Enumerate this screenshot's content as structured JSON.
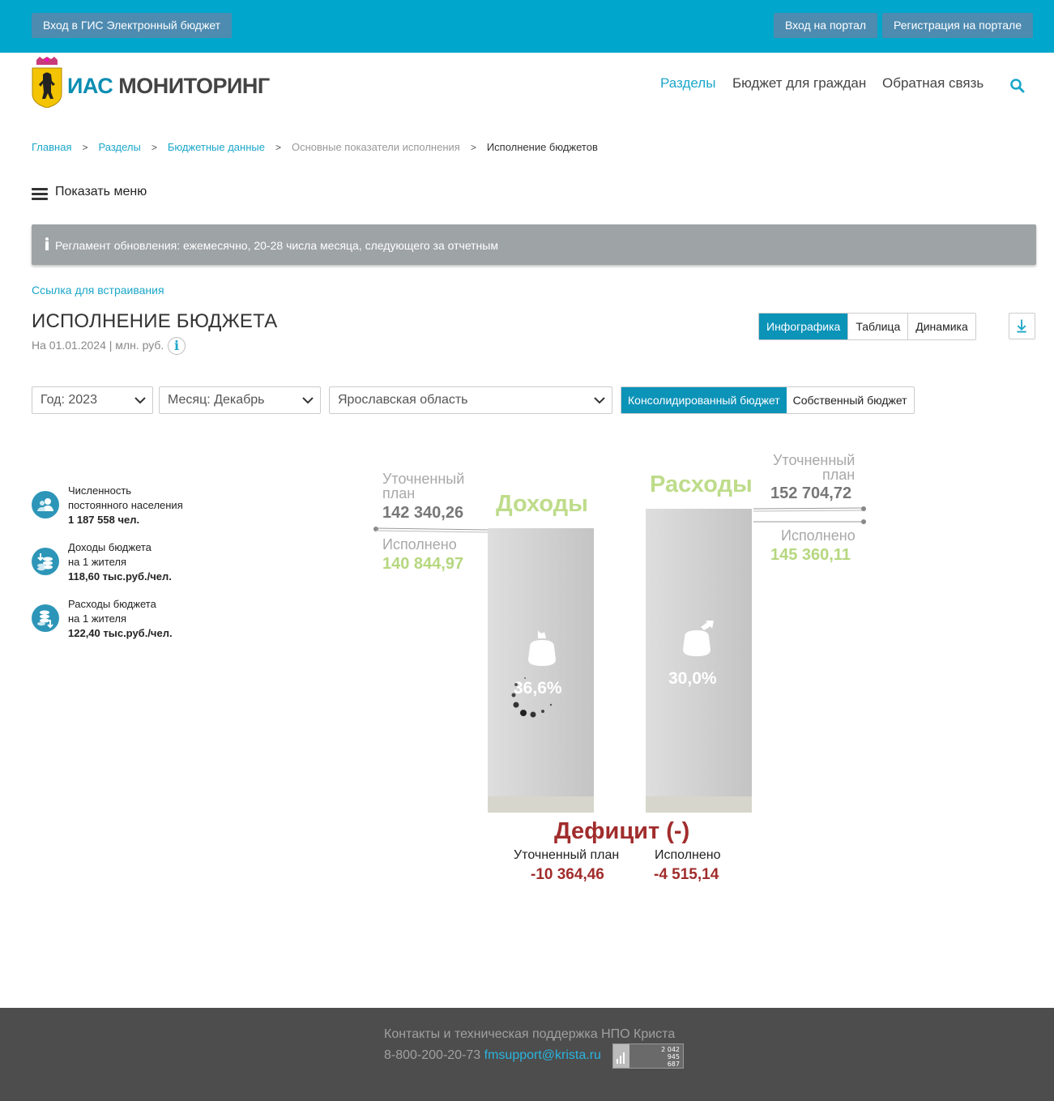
{
  "topbar": {
    "gis_login": "Вход в ГИС Электронный бюджет",
    "portal_login": "Вход на портал",
    "portal_register": "Регистрация на портале"
  },
  "header": {
    "logo_ias": "ИАС",
    "logo_monitoring": "МОНИТОРИНГ",
    "nav": [
      "Разделы",
      "Бюджет для граждан",
      "Обратная связь"
    ]
  },
  "breadcrumb": [
    "Главная",
    "Разделы",
    "Бюджетные данные",
    "Основные показатели исполнения",
    "Исполнение бюджетов"
  ],
  "menu_toggle": "Показать меню",
  "notice": "Регламент обновления: ежемесячно, 20-28 числа месяца, следующего за отчетным",
  "embed_link": "Ссылка для встраивания",
  "page_title": "ИСПОЛНЕНИЕ БЮДЖЕТА",
  "subtitle": "На 01.01.2024 | млн. руб.",
  "info_icon_glyph": "i",
  "view_tabs": [
    "Инфографика",
    "Таблица",
    "Динамика"
  ],
  "filters": {
    "year": "Год: 2023",
    "month": "Месяц: Декабрь",
    "region": "Ярославская область"
  },
  "budget_tabs": [
    "Консолидированный бюджет",
    "Собственный бюджет"
  ],
  "stats": [
    {
      "line1": "Численность",
      "line2": "постоянного населения",
      "value": "1 187 558 чел.",
      "icon": "people-icon"
    },
    {
      "line1": "Доходы бюджета",
      "line2": "на 1 жителя",
      "value": "118,60 тыс.руб./чел.",
      "icon": "coins-in-icon"
    },
    {
      "line1": "Расходы бюджета",
      "line2": "на 1 жителя",
      "value": "122,40 тыс.руб./чел.",
      "icon": "coins-out-icon"
    }
  ],
  "income": {
    "title": "Доходы",
    "plan_label_1": "Уточненный",
    "plan_label_2": "план",
    "plan_value": "142 340,26",
    "exec_label": "Исполнено",
    "exec_value": "140 844,97",
    "percent": "36,6%"
  },
  "expense": {
    "title": "Расходы",
    "plan_label_1": "Уточненный",
    "plan_label_2": "план",
    "plan_value": "152 704,72",
    "exec_label": "Исполнено",
    "exec_value": "145 360,11",
    "percent": "30,0%"
  },
  "deficit": {
    "title": "Дефицит (-)",
    "plan_label": "Уточненный план",
    "plan_value": "-10 364,46",
    "exec_label": "Исполнено",
    "exec_value": "-4 515,14"
  },
  "footer": {
    "contacts": "Контакты и техническая поддержка НПО Криста",
    "phone": "8-800-200-20-73",
    "email": "fmsupport@krista.ru",
    "counter": [
      "2 042",
      "945",
      "687"
    ]
  },
  "colors": {
    "topbar": "#00a6cb",
    "accent": "#0c93b8",
    "income_green": "#b6d77f",
    "deficit_red": "#a12c2c",
    "footer": "#4d4d4d"
  }
}
